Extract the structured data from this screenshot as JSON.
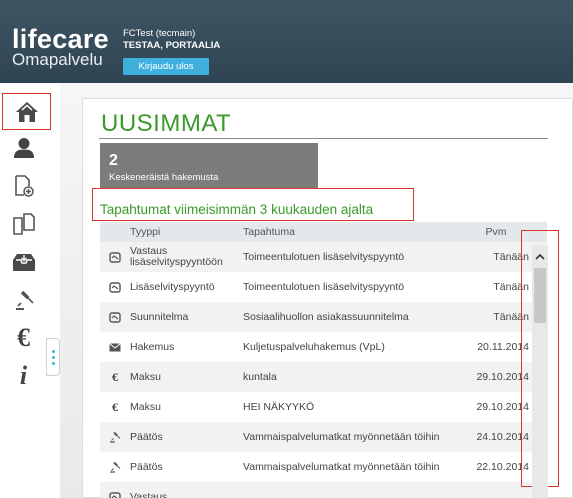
{
  "header": {
    "brand": "lifecare",
    "brand_sub": "Omapalvelu",
    "user_name": "FCTest (tecmain)",
    "user_org": "TESTAA, PORTAALIA",
    "logout_label": "Kirjaudu ulos"
  },
  "sidebar": {
    "items": [
      {
        "name": "home-icon"
      },
      {
        "name": "person-icon"
      },
      {
        "name": "new-document-icon"
      },
      {
        "name": "documents-icon"
      },
      {
        "name": "inbox-icon"
      },
      {
        "name": "gavel-icon"
      },
      {
        "name": "euro-icon",
        "glyph": "€"
      },
      {
        "name": "info-icon",
        "glyph": "i"
      }
    ]
  },
  "main": {
    "title": "UUSIMMAT",
    "stat": {
      "number": "2",
      "label": "Keskeneräistä hakemusta"
    },
    "section_title": "Tapahtumat viimeisimmän 3 kuukauden ajalta",
    "table": {
      "headers": {
        "type": "Tyyppi",
        "event": "Tapahtuma",
        "date": "Pvm"
      },
      "rows": [
        {
          "icon": "reply-icon",
          "type": "Vastaus lisäselvityspyyntöön",
          "event": "Toimeentulotuen lisäselvityspyyntö",
          "date": "Tänään"
        },
        {
          "icon": "reply-icon",
          "type": "Lisäselvityspyyntö",
          "event": "Toimeentulotuen lisäselvityspyyntö",
          "date": "Tänään"
        },
        {
          "icon": "reply-icon",
          "type": "Suunnitelma",
          "event": "Sosiaalihuollon asiakassuunnitelma",
          "date": "Tänään"
        },
        {
          "icon": "envelope-icon",
          "type": "Hakemus",
          "event": "Kuljetuspalveluhakemus (VpL)",
          "date": "20.11.2014"
        },
        {
          "icon": "euro-icon",
          "type": "Maksu",
          "event": "kuntala",
          "date": "29.10.2014"
        },
        {
          "icon": "euro-icon",
          "type": "Maksu",
          "event": "HEI NÄKYYKÖ",
          "date": "29.10.2014"
        },
        {
          "icon": "gavel-icon",
          "type": "Päätös",
          "event": "Vammaispalvelumatkat myönnetään töihin",
          "date": "24.10.2014"
        },
        {
          "icon": "gavel-icon",
          "type": "Päätös",
          "event": "Vammaispalvelumatkat myönnetään töihin",
          "date": "22.10.2014"
        },
        {
          "icon": "reply-icon",
          "type": "Vastaus",
          "event": "",
          "date": ""
        }
      ]
    }
  },
  "colors": {
    "accent_green": "#3a9a2a",
    "button_blue": "#3fb0de",
    "header_bg": "#34495a",
    "highlight_red": "#d9342b"
  }
}
